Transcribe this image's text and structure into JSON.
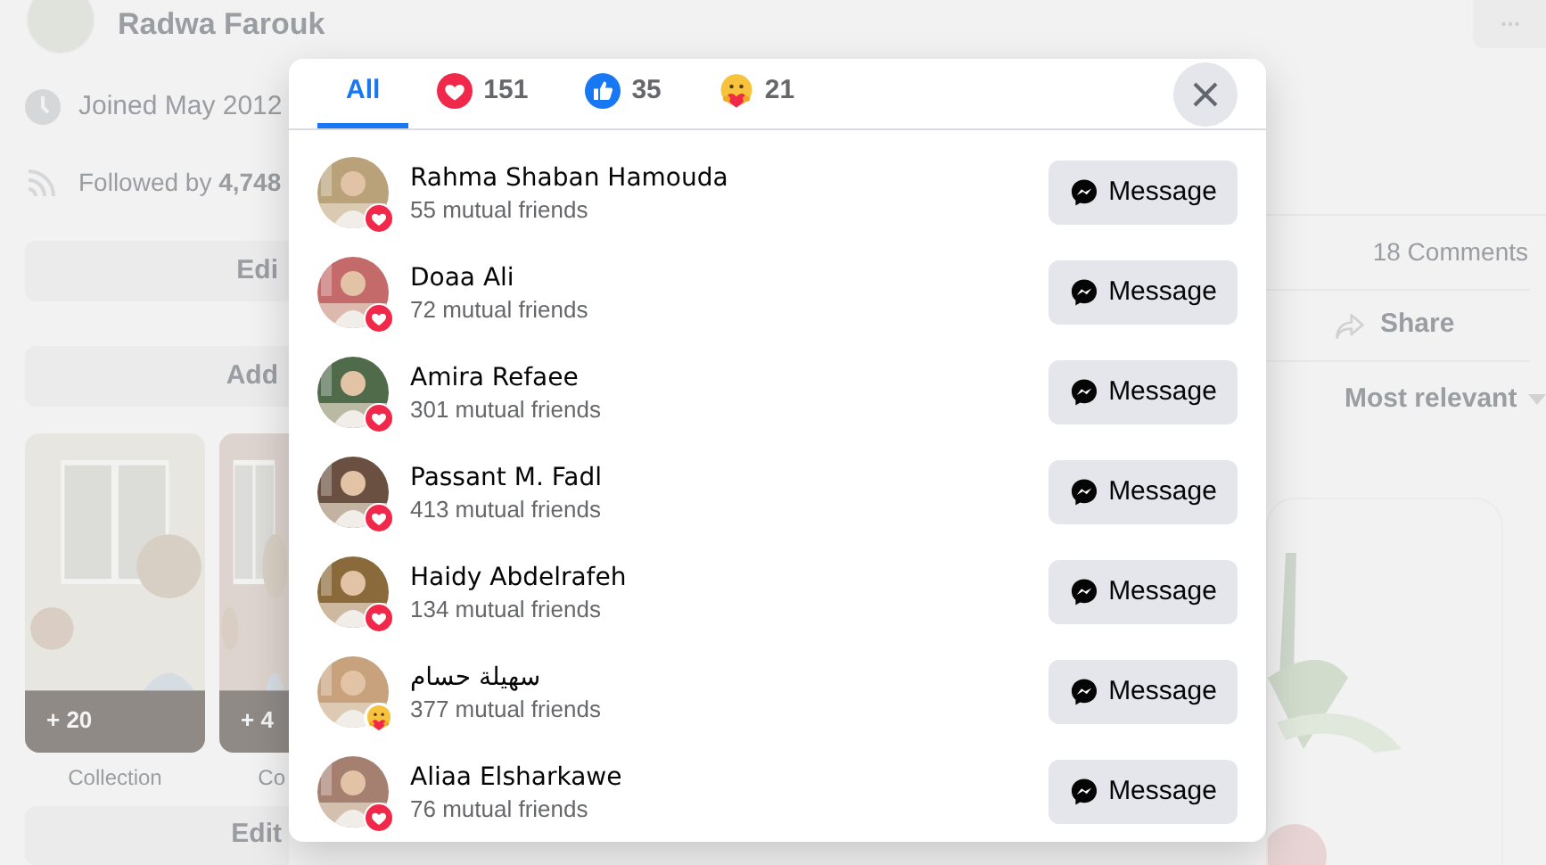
{
  "profile": {
    "name": "Radwa Farouk"
  },
  "intro": {
    "joined": "Joined May 2012",
    "followed": "Followed by **4,748**"
  },
  "left_buttons": [
    "Edi",
    "Add"
  ],
  "photos": [
    {
      "count": "+ 20",
      "caption": "Collection"
    },
    {
      "count": "+ 4",
      "caption": "Co"
    }
  ],
  "bottom_button": "Edit",
  "post": {
    "comments": "18 Comments",
    "share": "Share",
    "sort": "Most relevant"
  },
  "reactions_dialog": {
    "tabs": [
      {
        "kind": "all",
        "label": "All",
        "selected": true
      },
      {
        "kind": "love",
        "label": "151",
        "selected": false
      },
      {
        "kind": "like",
        "label": "35",
        "selected": false
      },
      {
        "kind": "care",
        "label": "21",
        "selected": false
      }
    ],
    "people": [
      {
        "name": "Rahma Shaban Hamouda",
        "mutual": "55 mutual friends",
        "reaction": {
          "kind": "love"
        },
        "button": "Message"
      },
      {
        "name": "Doaa Ali",
        "mutual": "72 mutual friends",
        "reaction": {
          "kind": "love"
        },
        "button": "Message"
      },
      {
        "name": "Amira Refaee",
        "mutual": "301 mutual friends",
        "reaction": {
          "kind": "love"
        },
        "button": "Message"
      },
      {
        "name": "Passant M. Fadl",
        "mutual": "413 mutual friends",
        "reaction": {
          "kind": "love"
        },
        "button": "Message"
      },
      {
        "name": "Haidy Abdelrafeh",
        "mutual": "134 mutual friends",
        "reaction": {
          "kind": "love"
        },
        "button": "Message"
      },
      {
        "name": "سهيلة حسام",
        "mutual": "377 mutual friends",
        "reaction": {
          "kind": "care"
        },
        "button": "Message"
      },
      {
        "name": "Aliaa Elsharkawe",
        "mutual": "76 mutual friends",
        "reaction": {
          "kind": "love"
        },
        "button": "Message"
      }
    ]
  }
}
